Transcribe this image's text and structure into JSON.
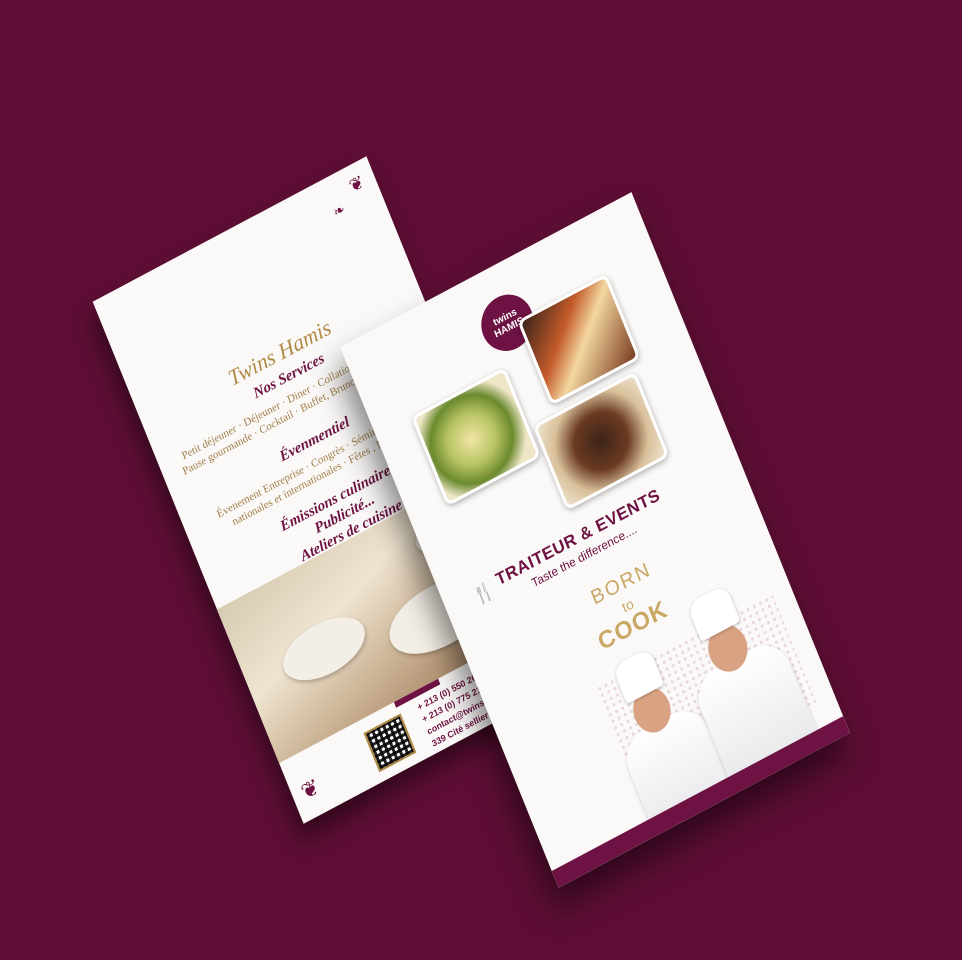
{
  "back_flyer": {
    "brand": "Twins Hamis",
    "services_title": "Nos Services",
    "services_text": "Petit déjeuner · Déjeuner · Diner · Collation · Pause Café · Pause gourmande · Cocktail · Buffet, Brunch · Coffret Repas",
    "events_title": "Évenmentiel",
    "events_text": "Évenement Entreprise · Congrès · Séminaires · Foires nationales et internationales · Fêtes , Mariages ...",
    "item_tv": "Émissions culinaires",
    "item_ads": "Publicité...",
    "item_workshops": "Ateliers de cuisine",
    "phone_1": "+ 213 (0) 550 26 2",
    "phone_2": "+ 213 (0) 775 21 0",
    "email": "contact@twinsha",
    "address": "339 Cité sellier H"
  },
  "front_flyer": {
    "logo_line1": "twins",
    "logo_line2": "HAMIS",
    "headline": "TRAITEUR & EVENTS",
    "tagline": "Taste the difference....",
    "born": "BORN",
    "to": "to",
    "cook": "COOK"
  },
  "colors": {
    "background": "#5e0e35",
    "brand_purple": "#6d1242",
    "gold": "#b08a45"
  }
}
